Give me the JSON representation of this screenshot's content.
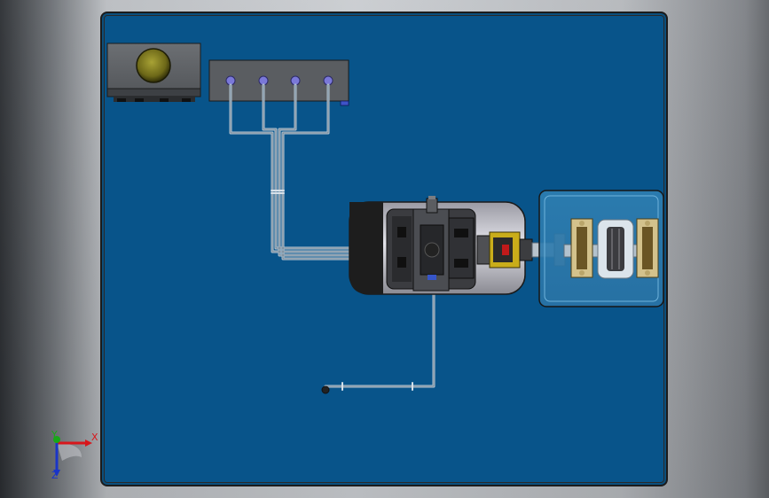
{
  "viewport": {
    "background": "gradient-gray",
    "plate_color": "#08548a"
  },
  "triad": {
    "x_label": "X",
    "y_label": "Y",
    "z_label": "Z",
    "x_color": "#d8161b",
    "y_color": "#18a818",
    "z_color": "#1a35c8"
  },
  "components": [
    {
      "name": "oil-tank-sight-glass",
      "icon": "sight-glass-icon"
    },
    {
      "name": "valve-manifold-block",
      "ports": 4
    },
    {
      "name": "hydraulic-pump-motor-assembly"
    },
    {
      "name": "coupling-housing"
    },
    {
      "name": "suction-line"
    }
  ]
}
